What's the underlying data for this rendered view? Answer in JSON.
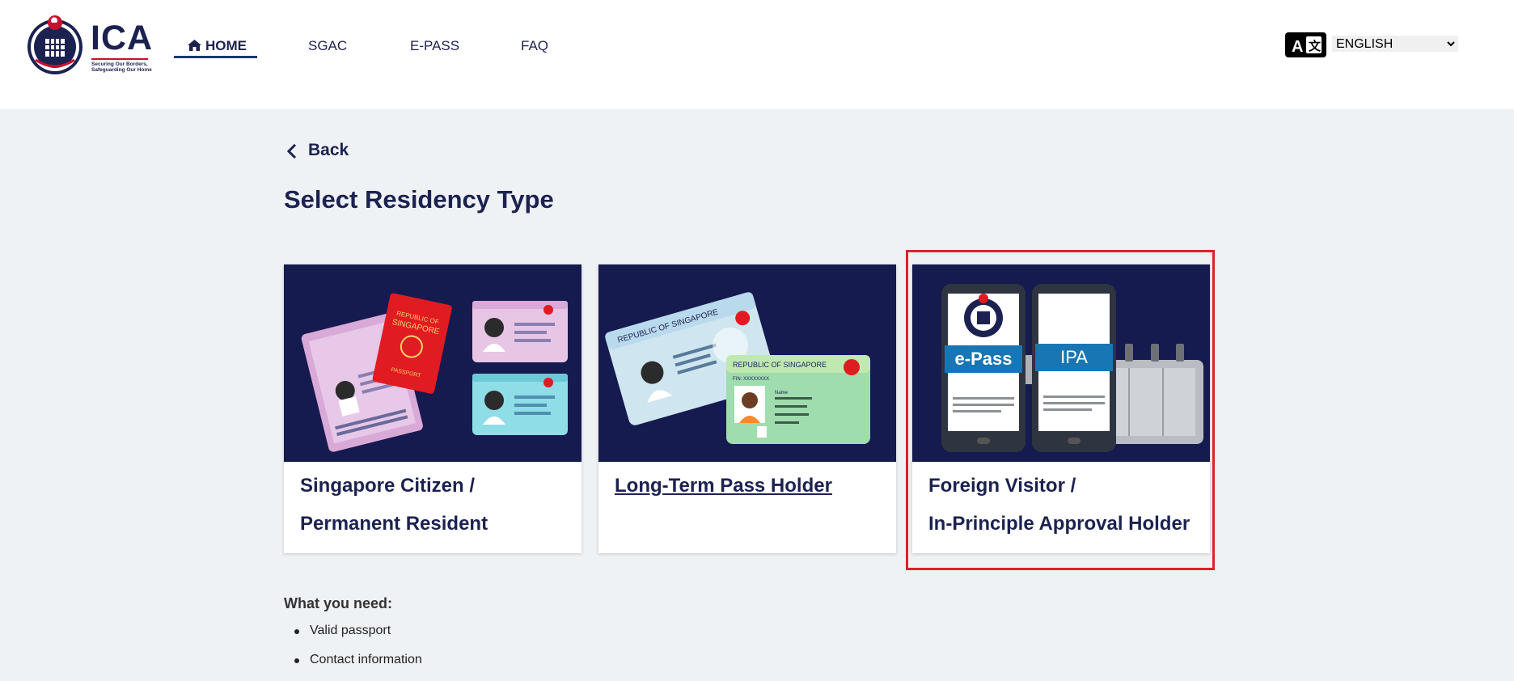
{
  "header": {
    "logo_text": "ICA",
    "logo_tagline_1": "Securing Our Borders,",
    "logo_tagline_2": "Safeguarding Our Home",
    "nav": [
      {
        "label": "HOME",
        "active": true
      },
      {
        "label": "SGAC",
        "active": false
      },
      {
        "label": "E-PASS",
        "active": false
      },
      {
        "label": "FAQ",
        "active": false
      }
    ],
    "language": {
      "icon": "translate-icon",
      "selected": "ENGLISH"
    }
  },
  "main": {
    "back_label": "Back",
    "title": "Select Residency Type",
    "cards": [
      {
        "line1": "Singapore Citizen /",
        "line2": "Permanent Resident",
        "image": "passport-nric-illustration"
      },
      {
        "line1": "Long-Term Pass Holder",
        "line2": "",
        "image": "ltvp-card-illustration"
      },
      {
        "line1": "Foreign Visitor /",
        "line2": "In-Principle Approval Holder",
        "image": "epass-ipa-phones-illustration",
        "highlighted": true
      }
    ],
    "card_art": {
      "passport_line1": "REPUBLIC OF",
      "passport_line2": "SINGAPORE",
      "passport_label": "PASSPORT",
      "ltp_header": "REPUBLIC OF SINGAPORE",
      "ltp_fin": "FIN: XXXXXXXX",
      "ltp_name": "Name",
      "phone_epass": "e-Pass",
      "phone_ipa": "IPA"
    },
    "requirements": {
      "title": "What you need:",
      "items": [
        "Valid passport",
        "Contact information"
      ]
    }
  },
  "colors": {
    "navy": "#1c2250",
    "card_bg": "#151a4f",
    "highlight": "#e0202a",
    "accent_red": "#c8102e"
  }
}
